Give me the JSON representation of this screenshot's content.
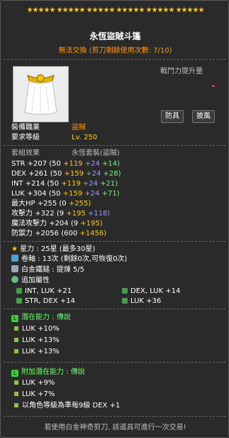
{
  "item": {
    "stars": "★★★★★  ★★★★★  ★★★★★  ★★★★★  ★★★★★  ★★★★★",
    "name": "永恆盜賊斗篷",
    "trade_note": "無法交換 (剪刀剩餘使用次數: 7/10)",
    "power_label": "戰鬥力提升量",
    "power_value": "-",
    "tags": [
      "防具",
      "披風"
    ],
    "job_label": "裝備職業",
    "job_value": "盜賊",
    "level_label": "要求等級",
    "level_value": "Lv. 250",
    "set_label": "套組效果",
    "set_value": "永恆套裝(盜賊)"
  },
  "stats": [
    {
      "name": "STR",
      "total": "+207",
      "base": "(50",
      "b1": "+119",
      "b2": "+24",
      "b3": "+14)"
    },
    {
      "name": "DEX",
      "total": "+261",
      "base": "(50",
      "b1": "+159",
      "b2": "+24",
      "b3": "+28)"
    },
    {
      "name": "INT",
      "total": "+214",
      "base": "(50",
      "b1": "+119",
      "b2": "+24",
      "b3": "+21)"
    },
    {
      "name": "LUK",
      "total": "+304",
      "base": "(50",
      "b1": "+159",
      "b2": "+24",
      "b3": "+71)"
    }
  ],
  "stats2": [
    {
      "name": "最大HP",
      "total": "+255",
      "base": "(0",
      "b1": "+255)"
    },
    {
      "name": "攻擊力",
      "total": "+322",
      "base": "(9",
      "b1": "+195",
      "b2": "+118)"
    },
    {
      "name": "魔法攻擊力",
      "total": "+204",
      "base": "(9",
      "b1": "+195)"
    },
    {
      "name": "防禦力",
      "total": "+2056",
      "base": "(600",
      "b1": "+1456)"
    }
  ],
  "enhance": {
    "star": "星力 : 25星 (最多30星)",
    "scroll": "卷軸 : 13次 (剩餘0次,可恢復0次)",
    "hammer": "白金鐵鎚 : 提煉 5/5",
    "extra_label": "追加屬性",
    "extra": [
      "INT, LUK  +21",
      "DEX, LUK  +14",
      "STR, DEX  +14",
      "LUK  +36"
    ]
  },
  "potential": {
    "title": "潛在能力 : 傳說",
    "lines": [
      "LUK +10%",
      "LUK +13%",
      "LUK +13%"
    ]
  },
  "additional": {
    "title": "附加潛在能力 : 傳說",
    "lines": [
      "LUK +9%",
      "LUK +7%",
      "以角色等級為準每9級 DEX +1"
    ]
  },
  "footer": "若使用白金神奇剪刀, 該道具可進行一次交易!"
}
